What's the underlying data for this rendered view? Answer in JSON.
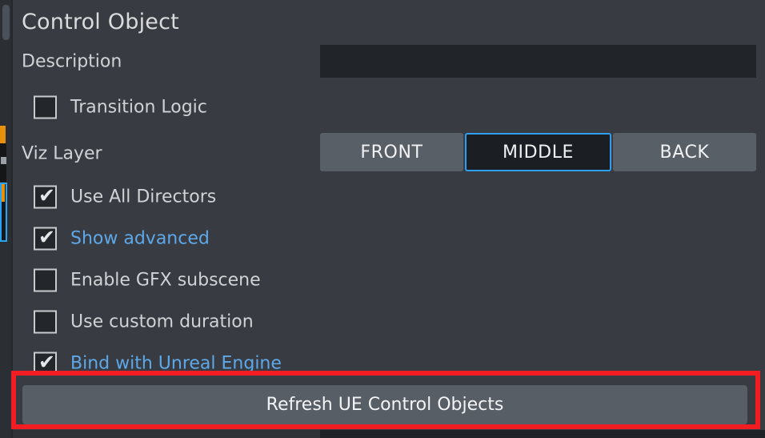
{
  "panel": {
    "title": "Control Object"
  },
  "description": {
    "label": "Description",
    "value": "",
    "placeholder": ""
  },
  "transition_logic": {
    "label": "Transition Logic",
    "checked": false
  },
  "viz_layer": {
    "label": "Viz Layer",
    "options": [
      "FRONT",
      "MIDDLE",
      "BACK"
    ],
    "selected": "MIDDLE"
  },
  "checkboxes": [
    {
      "label": "Use All Directors",
      "checked": true,
      "link": false
    },
    {
      "label": "Show advanced",
      "checked": true,
      "link": true
    },
    {
      "label": "Enable GFX subscene",
      "checked": false,
      "link": false
    },
    {
      "label": "Use custom duration",
      "checked": false,
      "link": false
    },
    {
      "label": "Bind with Unreal Engine",
      "checked": true,
      "link": true
    }
  ],
  "refresh": {
    "label": "Refresh UE Control Objects"
  },
  "icons": {
    "check": "✔"
  },
  "colors": {
    "panel_bg": "#383c42",
    "accent_blue": "#2e9ef0",
    "link_blue": "#5fa8e8",
    "highlight_red": "#f11d22",
    "marker_orange": "#e8900c",
    "button_gray": "#585e65"
  }
}
